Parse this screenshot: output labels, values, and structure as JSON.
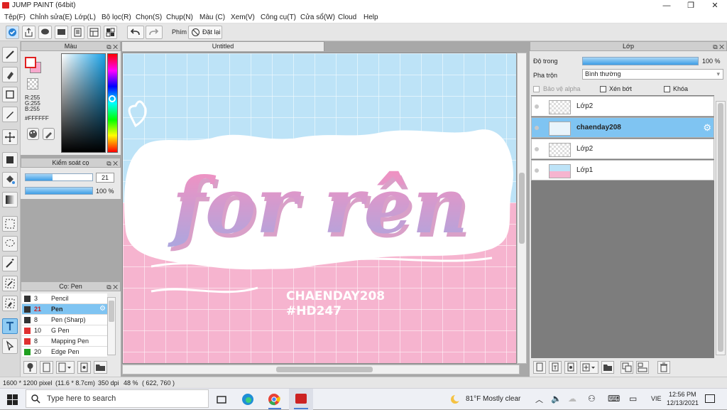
{
  "app": {
    "title": "JUMP PAINT (64bit)"
  },
  "menu": [
    "Tệp(F)",
    "Chỉnh sửa(E)",
    "Lớp(L)",
    "Bộ lọc(R)",
    "Chọn(S)",
    "Chụp(N)",
    "Màu (C)",
    "Xem(V)",
    "Công cụ(T)",
    "Cửa sổ(W)",
    "Cloud",
    "Help"
  ],
  "toolbar": {
    "key_label": "Phím",
    "reset_label": "Đặt lại"
  },
  "color_panel": {
    "title": "Màu",
    "r": "R:255",
    "g": "G:255",
    "b": "B:255",
    "hex": "#FFFFFF"
  },
  "brush_control": {
    "title": "Kiểm soát cọ",
    "size_value": "21",
    "size_fraction": 0.4,
    "opacity_label": "100 %",
    "opacity_fraction": 1.0
  },
  "brush_panel": {
    "title": "Cọ: Pen",
    "brushes": [
      {
        "size": "3",
        "name": "Pencil",
        "color": "#333333"
      },
      {
        "size": "21",
        "name": "Pen",
        "color": "#333333",
        "selected": true
      },
      {
        "size": "8",
        "name": "Pen (Sharp)",
        "color": "#333333"
      },
      {
        "size": "10",
        "name": "G Pen",
        "color": "#e03030"
      },
      {
        "size": "8",
        "name": "Mapping Pen",
        "color": "#e03030"
      },
      {
        "size": "20",
        "name": "Edge Pen",
        "color": "#20a020"
      }
    ]
  },
  "document": {
    "tab": "Untitled"
  },
  "artwork": {
    "headline": "for rên",
    "line1": "CHAENDAY208",
    "line2": "#HD247"
  },
  "layer_panel": {
    "title": "Lớp",
    "opacity_label": "Độ trong",
    "opacity_value": "100 %",
    "opacity_fraction": 1.0,
    "blend_label": "Pha trộn",
    "blend_value": "Bình thường",
    "protect_alpha": "Bảo vệ alpha",
    "clipping": "Xén bớt",
    "lock": "Khóa",
    "layers": [
      {
        "name": "Lớp2",
        "selected": false
      },
      {
        "name": "chaenday208",
        "selected": true
      },
      {
        "name": "Lớp2",
        "selected": false
      },
      {
        "name": "Lớp1",
        "selected": false
      }
    ]
  },
  "status": {
    "size": "1600 * 1200 pixel",
    "cm": "(11.6 * 8.7cm)",
    "dpi": "350 dpi",
    "zoom": "48 %",
    "coords": "( 622, 760 )"
  },
  "taskbar": {
    "search_placeholder": "Type here to search",
    "weather": "81°F  Mostly clear",
    "lang": "VIE",
    "time": "12:56 PM",
    "date": "12/13/2021"
  },
  "colors": {
    "selection": "#7fc4f2",
    "canvas_blue": "#bde3f7",
    "canvas_pink": "#f6b4cf"
  }
}
